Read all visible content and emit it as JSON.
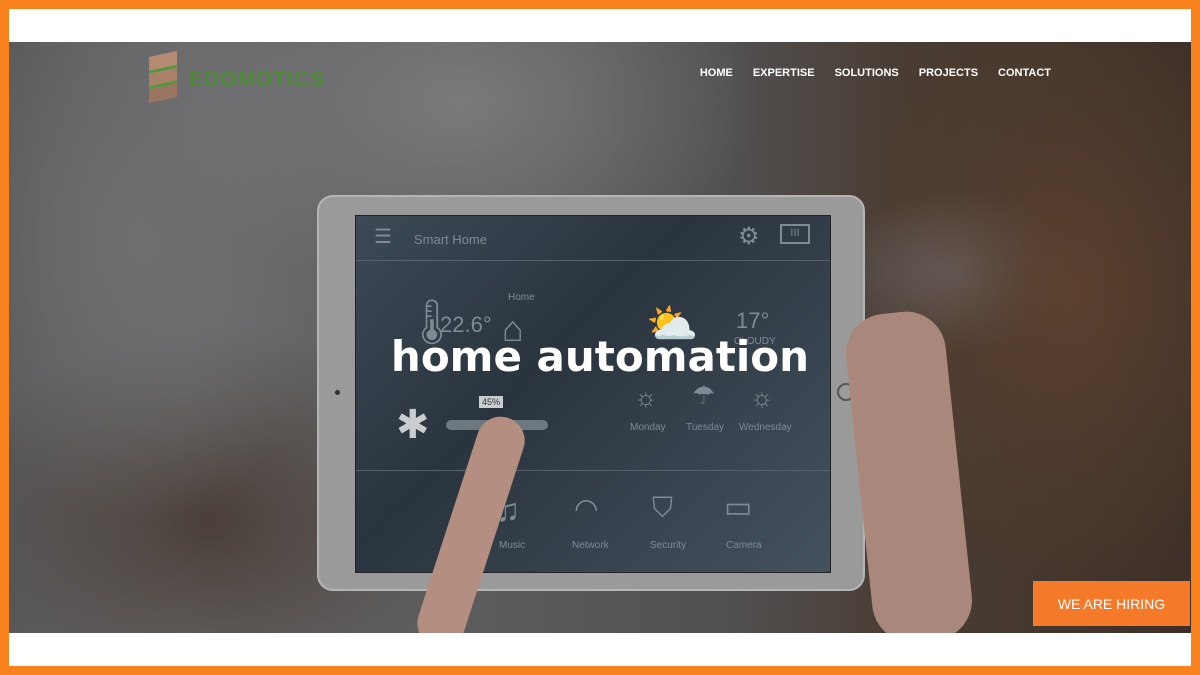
{
  "brand": {
    "name": "EDOMOTICS",
    "accent": "#f7821e"
  },
  "nav": {
    "items": [
      "HOME",
      "EXPERTISE",
      "SOLUTIONS",
      "PROJECTS",
      "CONTACT"
    ]
  },
  "hero": {
    "title": "home automation",
    "cta": "WE ARE HIRING"
  },
  "tablet": {
    "app_title": "Smart Home",
    "temperature": "22.6°",
    "home_label": "Home",
    "weather_temp": "17°",
    "weather_label": "CLOUDY",
    "fan_level": "45%",
    "days": [
      "Monday",
      "Tuesday",
      "Wednesday"
    ],
    "controls": [
      "Music",
      "Network",
      "Security",
      "Camera"
    ]
  }
}
